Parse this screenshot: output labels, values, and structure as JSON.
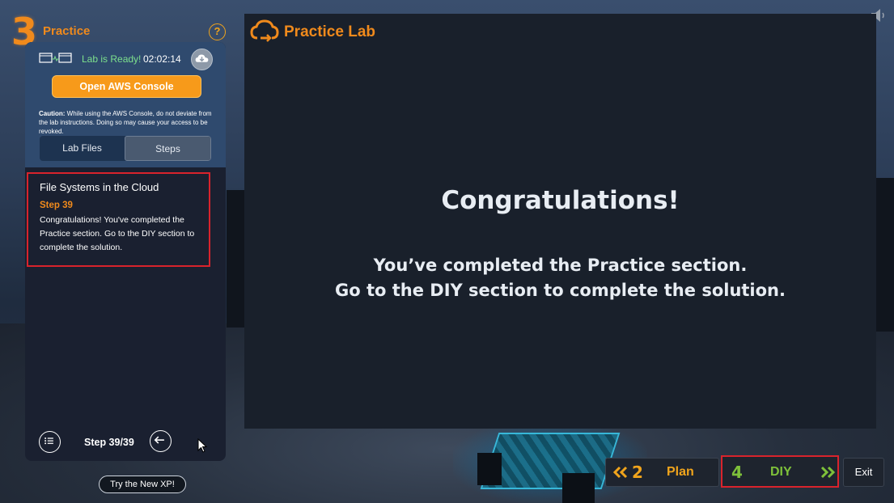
{
  "header": {
    "step_number": "3",
    "step_title": "Practice",
    "help_label": "?"
  },
  "lab": {
    "status": "Lab is Ready!",
    "timer": "02:02:14",
    "open_console_label": "Open AWS Console",
    "caution_prefix": "Caution:",
    "caution_text": " While using the AWS Console, do not deviate from the lab instructions. Doing so may cause your access to be revoked."
  },
  "tabs": [
    {
      "label": "Lab Files",
      "active": false
    },
    {
      "label": "Steps",
      "active": true
    }
  ],
  "step_card": {
    "title": "File Systems in the Cloud",
    "step_label": "Step 39",
    "text": "Congratulations! You've completed the Practice section. Go to the DIY section to complete the solution."
  },
  "footer": {
    "step_count": "Step 39/39",
    "try_label": "Try the New XP!"
  },
  "main": {
    "brand": "Practice Lab",
    "heading": "Congratulations!",
    "line1": "You’ve completed the Practice section.",
    "line2": "Go to the DIY section to complete the solution."
  },
  "nav": {
    "prev_number": "2",
    "prev_label": "Plan",
    "next_number": "4",
    "next_label": "DIY",
    "exit_label": "Exit"
  },
  "colors": {
    "accent_orange": "#f08a1c",
    "diy_green": "#7ec13a",
    "ready_green": "#7de08d",
    "highlight_red": "#d9232c"
  },
  "icons": [
    "speaker-icon",
    "lab-connection-icon",
    "cloud-download-icon",
    "list-icon",
    "back-arrow-icon",
    "cursor-icon",
    "cloud-logo-icon",
    "chevron-left-double-icon",
    "chevron-right-double-icon"
  ]
}
